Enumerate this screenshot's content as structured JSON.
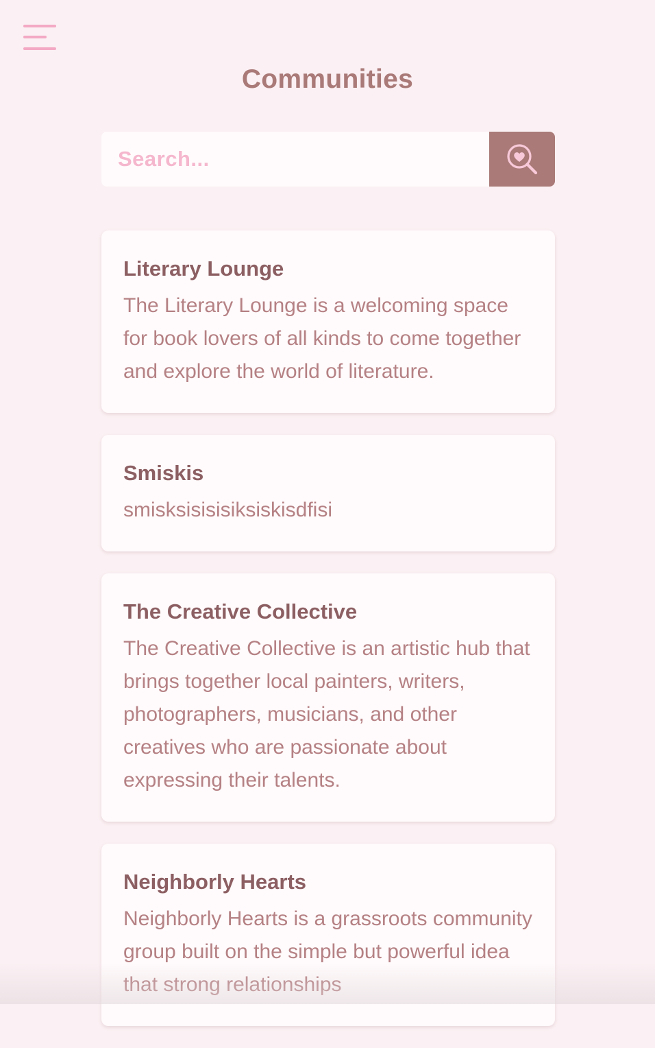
{
  "header": {
    "title": "Communities",
    "menu_icon": "hamburger-menu-icon"
  },
  "search": {
    "placeholder": "Search...",
    "value": "",
    "button_icon": "heart-magnifier-search-icon"
  },
  "communities": [
    {
      "name": "Literary Lounge",
      "description": "The Literary Lounge is a welcoming space for book lovers of all kinds to come together and explore the world of literature."
    },
    {
      "name": "Smiskis",
      "description": "smisksisisisiksiskisdfisi"
    },
    {
      "name": "The Creative Collective",
      "description": "The Creative Collective is an artistic hub that brings together local painters, writers, photographers, musicians, and other creatives who are passionate about expressing their talents."
    },
    {
      "name": "Neighborly Hearts",
      "description": "Neighborly Hearts is a grassroots community group built on the simple but powerful idea that strong relationships"
    }
  ],
  "colors": {
    "background": "#fbf0f3",
    "accent": "#a97a78",
    "menu_pink": "#f3a9c4",
    "card_title": "#8c5f63",
    "card_text": "#b58184",
    "placeholder": "#f5b7cd"
  }
}
